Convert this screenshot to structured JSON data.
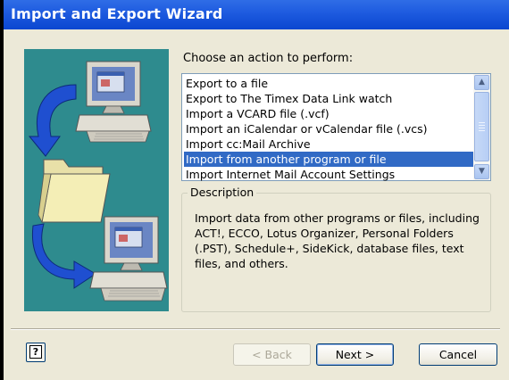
{
  "window": {
    "title": "Import and Export Wizard"
  },
  "main": {
    "prompt": "Choose an action to perform:",
    "actions": [
      "Export to a file",
      "Export to The Timex Data Link watch",
      "Import a VCARD file (.vcf)",
      "Import an iCalendar or vCalendar file (.vcs)",
      "Import cc:Mail Archive",
      "Import from another program or file",
      "Import Internet Mail Account Settings"
    ],
    "selected_index": 5,
    "description": {
      "legend": "Description",
      "line1": "Import data from other programs or files, including",
      "line2": "ACT!, ECCO, Lotus Organizer, Personal Folders",
      "line3": "(.PST), Schedule+, SideKick, database files, text",
      "line4": "files, and others."
    }
  },
  "buttons": {
    "help": "?",
    "back": "< Back",
    "next": "Next >",
    "cancel": "Cancel"
  },
  "colors": {
    "titlebar": "#0a46d0",
    "illustration_bg": "#2e8b8e",
    "selection": "#316ac5"
  }
}
